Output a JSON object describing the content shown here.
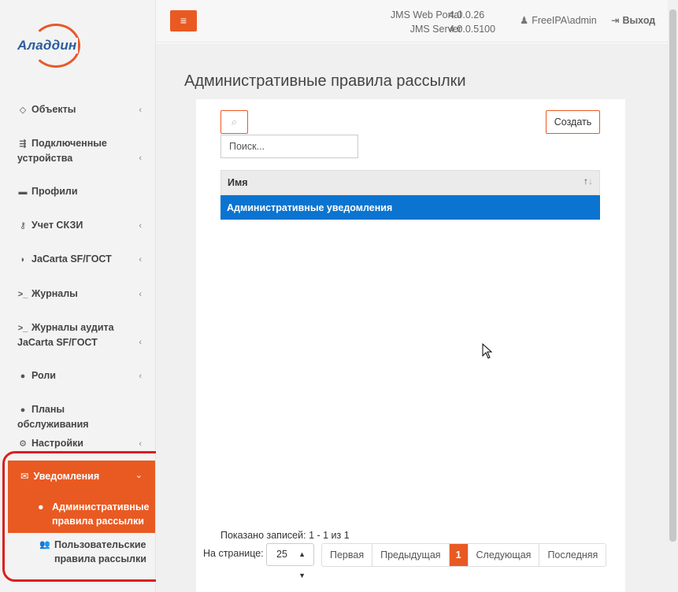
{
  "brand": {
    "logo_text": "Аладдин",
    "accent": "#e95a22",
    "logo_blue": "#2a5d9e"
  },
  "header": {
    "portal_label": "JMS Web Portal",
    "portal_version": "4.0.0.26",
    "server_label": "JMS Server",
    "server_version": "4.0.0.5100",
    "user": "FreeIPA\\admin",
    "logout": "Выход",
    "menu_icon": "bars-icon"
  },
  "sidebar": {
    "items": [
      {
        "label": "Объекты",
        "icon": "diamond-icon",
        "has_children": true
      },
      {
        "label": "Подключенные устройства",
        "icon": "usb-icon",
        "has_children": true
      },
      {
        "label": "Профили",
        "icon": "folder-icon",
        "has_children": false
      },
      {
        "label": "Учет СКЗИ",
        "icon": "key-icon",
        "has_children": true
      },
      {
        "label": "JaCarta SF/ГОСТ",
        "icon": "shield-icon",
        "has_children": true
      },
      {
        "label": "Журналы",
        "icon": "terminal-icon",
        "has_children": true
      },
      {
        "label": "Журналы аудита JaCarta SF/ГОСТ",
        "icon": "terminal-icon",
        "has_children": true
      },
      {
        "label": "Роли",
        "icon": "user-circle-icon",
        "has_children": true
      },
      {
        "label": "Планы обслуживания",
        "icon": "user-circle-icon",
        "has_children": false
      },
      {
        "label": "Настройки",
        "icon": "gears-icon",
        "has_children": true
      }
    ],
    "notifications": {
      "label": "Уведомления",
      "icon": "envelope-icon",
      "children": [
        {
          "label": "Административные правила рассылки",
          "icon": "user-circle-icon",
          "active": true
        },
        {
          "label": "Пользовательские правила рассылки",
          "icon": "users-icon",
          "active": false
        }
      ]
    }
  },
  "main": {
    "title": "Административные правила рассылки",
    "search_placeholder": "Поиск...",
    "create_button": "Создать",
    "table": {
      "columns": [
        "Имя"
      ],
      "rows": [
        [
          "Административные уведомления"
        ]
      ],
      "selected_row_color": "#0a74d0"
    },
    "info": "Показано записей: 1 - 1 из 1",
    "per_page_label": "На странице:",
    "per_page_value": "25",
    "pager": {
      "first": "Первая",
      "prev": "Предыдущая",
      "current": "1",
      "next": "Следующая",
      "last": "Последняя"
    }
  }
}
